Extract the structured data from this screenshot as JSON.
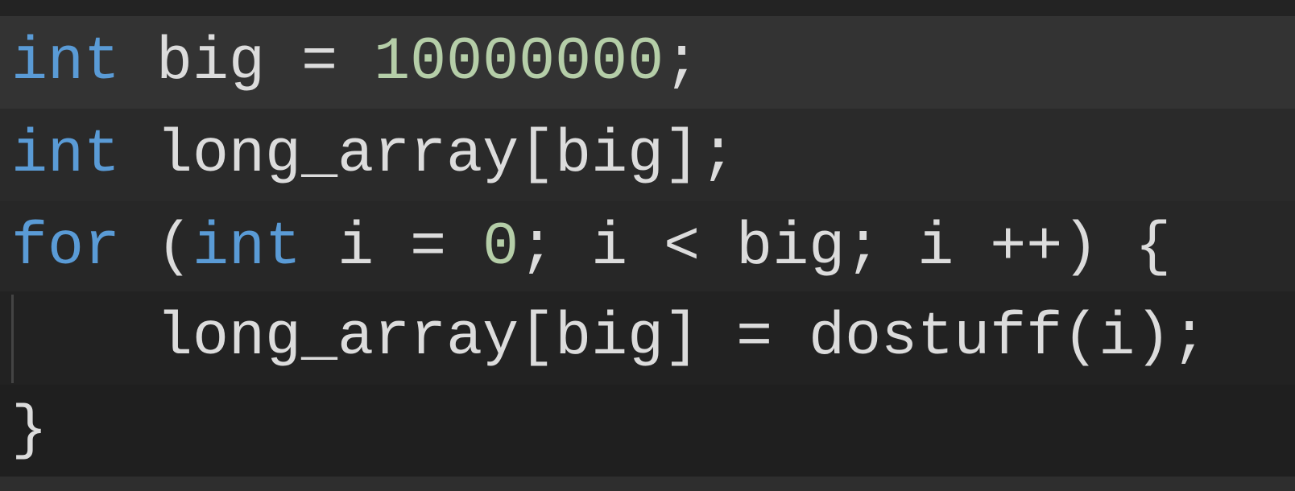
{
  "colors": {
    "keyword": "#5a9bd6",
    "number": "#b5cea8",
    "plain": "#dcdcdc",
    "current_line": "#333333"
  },
  "code": {
    "lines": [
      {
        "tokens": [
          {
            "t": "int",
            "k": "keyword"
          },
          {
            "t": " big = ",
            "k": "plain"
          },
          {
            "t": "10000000",
            "k": "number"
          },
          {
            "t": ";",
            "k": "plain"
          }
        ]
      },
      {
        "tokens": [
          {
            "t": "int",
            "k": "keyword"
          },
          {
            "t": " long_array[big];",
            "k": "plain"
          }
        ]
      },
      {
        "tokens": [
          {
            "t": "for",
            "k": "keyword"
          },
          {
            "t": " (",
            "k": "plain"
          },
          {
            "t": "int",
            "k": "keyword"
          },
          {
            "t": " i = ",
            "k": "plain"
          },
          {
            "t": "0",
            "k": "number"
          },
          {
            "t": "; i < big; i ++) {",
            "k": "plain"
          }
        ]
      },
      {
        "tokens": [
          {
            "t": "    long_array[big] = dostuff(i);",
            "k": "plain"
          }
        ]
      },
      {
        "tokens": [
          {
            "t": "}",
            "k": "plain"
          }
        ]
      }
    ]
  }
}
